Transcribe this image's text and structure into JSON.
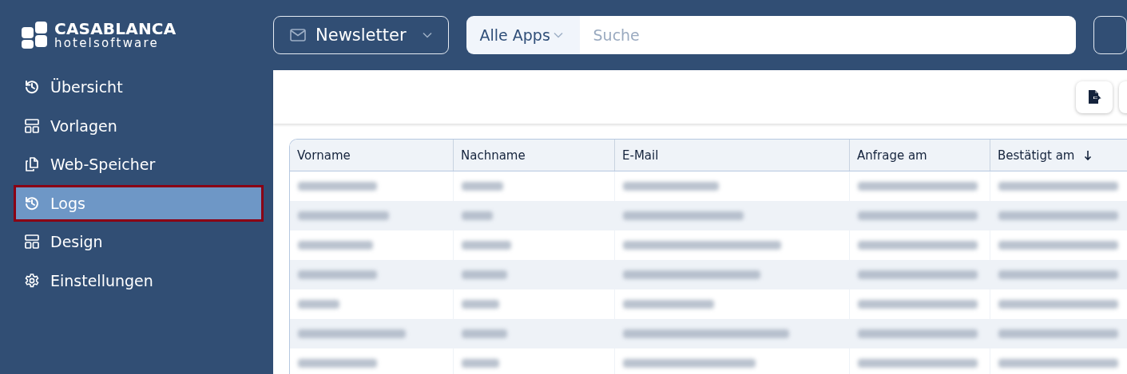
{
  "logo": {
    "name": "CASABLANCA",
    "tagline": "hotelsoftware"
  },
  "app_switcher": {
    "label": "Newsletter"
  },
  "search": {
    "scope": "Alle Apps",
    "placeholder": "Suche"
  },
  "sidebar": {
    "items": [
      {
        "label": "Übersicht",
        "kind": "history",
        "selected": false,
        "highlighted": false
      },
      {
        "label": "Vorlagen",
        "kind": "layout",
        "selected": false,
        "highlighted": false
      },
      {
        "label": "Web-Speicher",
        "kind": "copy",
        "selected": false,
        "highlighted": false
      },
      {
        "label": "Logs",
        "kind": "history",
        "selected": true,
        "highlighted": true
      },
      {
        "label": "Design",
        "kind": "layout",
        "selected": false,
        "highlighted": false
      },
      {
        "label": "Einstellungen",
        "kind": "gear",
        "selected": false,
        "highlighted": false
      }
    ]
  },
  "table": {
    "columns": [
      {
        "label": "Vorname",
        "sorted": false
      },
      {
        "label": "Nachname",
        "sorted": false
      },
      {
        "label": "E-Mail",
        "sorted": false
      },
      {
        "label": "Anfrage am",
        "sorted": false
      },
      {
        "label": "Bestätigt am",
        "sorted": true
      }
    ],
    "rows": [
      {
        "redacted": true
      },
      {
        "redacted": true
      },
      {
        "redacted": true
      },
      {
        "redacted": true
      },
      {
        "redacted": true
      },
      {
        "redacted": true
      },
      {
        "redacted": true
      }
    ]
  }
}
